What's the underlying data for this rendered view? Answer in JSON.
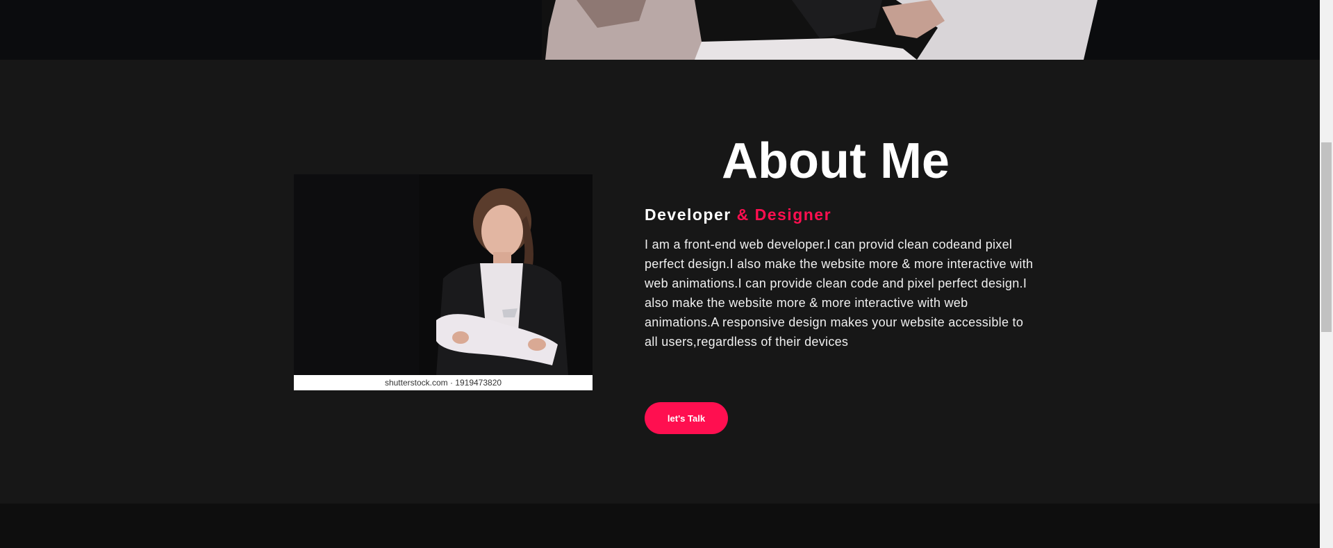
{
  "about": {
    "title": "About Me",
    "subtitle_main": "Developer",
    "subtitle_accent": " & Designer",
    "bio": "I am a front-end web developer.I can provid clean codeand pixel perfect design.I also make the website more & more interactive with web animations.I can provide clean code and pixel perfect design.I also make the website more & more interactive with web animations.A responsive design makes your website accessible to all users,regardless of their devices",
    "cta_label": "let's Talk",
    "photo_watermark": "shutterstock.com · 1919473820"
  },
  "colors": {
    "accent": "#ff0f50",
    "section_bg": "#171717",
    "hero_bg": "#0b0c0e",
    "footer_bg": "#0e0e0e"
  },
  "icons": {
    "photo": "portrait-photo"
  }
}
